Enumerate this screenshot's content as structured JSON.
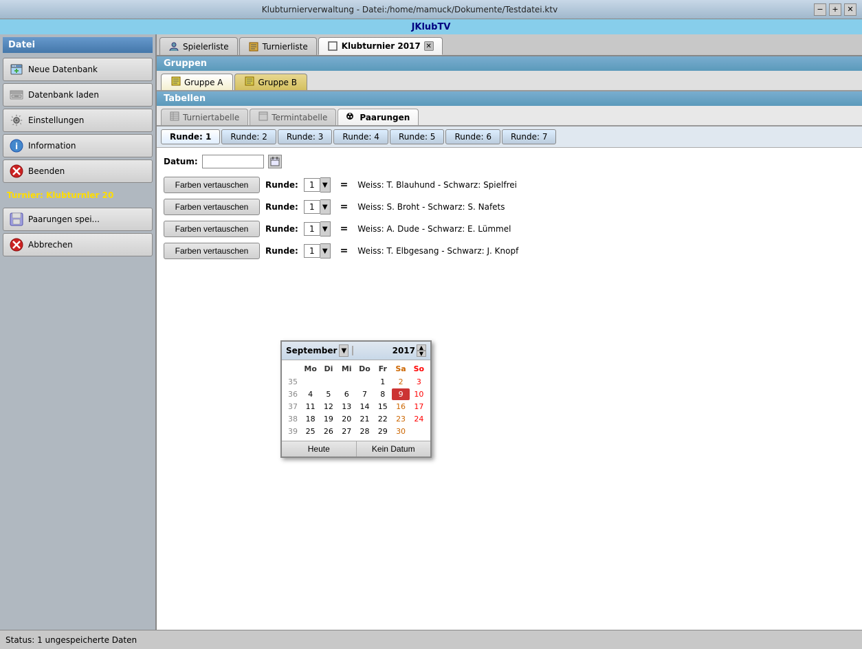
{
  "window": {
    "title": "Klubturnierverwaltung - Datei:/home/mamuck/Dokumente/Testdatei.ktv",
    "app_name": "JKlubTV",
    "minimize": "−",
    "maximize": "+",
    "close": "✕"
  },
  "sidebar": {
    "title": "Datei",
    "buttons": [
      {
        "id": "neue-datenbank",
        "label": "Neue Datenbank",
        "icon": "💾+"
      },
      {
        "id": "datenbank-laden",
        "label": "Datenbank laden",
        "icon": "🖥"
      },
      {
        "id": "einstellungen",
        "label": "Einstellungen",
        "icon": "🔧"
      },
      {
        "id": "information",
        "label": "Information",
        "icon": "ℹ"
      },
      {
        "id": "beenden",
        "label": "Beenden",
        "icon": "⛔"
      }
    ],
    "tournament_label": "Turnier: Klubturnler 20"
  },
  "tabs": [
    {
      "id": "spielerliste",
      "label": "Spielerliste",
      "icon": "👤",
      "active": false
    },
    {
      "id": "turnierliste",
      "label": "Turnierliste",
      "icon": "📋",
      "active": false
    },
    {
      "id": "klubturnier",
      "label": "Klubturnier 2017",
      "icon": "□",
      "active": true,
      "closable": true
    }
  ],
  "sections": {
    "gruppen_label": "Gruppen",
    "tabellen_label": "Tabellen"
  },
  "group_tabs": [
    {
      "id": "gruppe-a",
      "label": "Gruppe A",
      "active": true
    },
    {
      "id": "gruppe-b",
      "label": "Gruppe B",
      "active": false
    }
  ],
  "table_tabs": [
    {
      "id": "turniertabelle",
      "label": "Turniertabelle",
      "active": false
    },
    {
      "id": "termintabelle",
      "label": "Termintabelle",
      "active": false
    },
    {
      "id": "paarungen",
      "label": "Paarungen",
      "active": true
    }
  ],
  "round_tabs": [
    {
      "id": "runde-1",
      "label": "Runde: 1",
      "active": true
    },
    {
      "id": "runde-2",
      "label": "Runde: 2"
    },
    {
      "id": "runde-3",
      "label": "Runde: 3"
    },
    {
      "id": "runde-4",
      "label": "Runde: 4"
    },
    {
      "id": "runde-5",
      "label": "Runde: 5"
    },
    {
      "id": "runde-6",
      "label": "Runde: 6"
    },
    {
      "id": "runde-7",
      "label": "Runde: 7"
    }
  ],
  "paarungen": {
    "datum_label": "Datum:",
    "datum_value": "",
    "farben_btn": "Farben vertauschen",
    "rows": [
      {
        "runde_val": "1",
        "text": "Weiss: T. Blauhund  -  Schwarz: Spielfrei"
      },
      {
        "runde_val": "1",
        "text": "Weiss: S. Broht  -  Schwarz: S. Nafets"
      },
      {
        "runde_val": "1",
        "text": "Weiss: A. Dude  -  Schwarz: E. Lümmel"
      },
      {
        "runde_val": "1",
        "text": "Weiss: T. Elbgesang  -  Schwarz: J. Knopf"
      }
    ],
    "runde_label": "Runde:"
  },
  "calendar": {
    "month": "September",
    "year": "2017",
    "days_header": [
      "Mo",
      "Di",
      "Mi",
      "Do",
      "Fr",
      "Sa",
      "So"
    ],
    "weeks": [
      {
        "week_num": "35",
        "days": [
          "",
          "",
          "",
          "",
          "1",
          "2",
          "3"
        ]
      },
      {
        "week_num": "36",
        "days": [
          "4",
          "5",
          "6",
          "7",
          "8",
          "9",
          "10"
        ]
      },
      {
        "week_num": "37",
        "days": [
          "11",
          "12",
          "13",
          "14",
          "15",
          "16",
          "17"
        ]
      },
      {
        "week_num": "38",
        "days": [
          "18",
          "19",
          "20",
          "21",
          "22",
          "23",
          "24"
        ]
      },
      {
        "week_num": "39",
        "days": [
          "25",
          "26",
          "27",
          "28",
          "29",
          "30",
          ""
        ]
      }
    ],
    "today_day": "9",
    "today_week": "36",
    "btn_heute": "Heute",
    "btn_kein_datum": "Kein Datum"
  },
  "save_button": {
    "label": "Paarungen spei..."
  },
  "cancel_button": {
    "label": "Abbrechen"
  },
  "status_bar": {
    "text": "Status: 1 ungespeicherte Daten"
  }
}
